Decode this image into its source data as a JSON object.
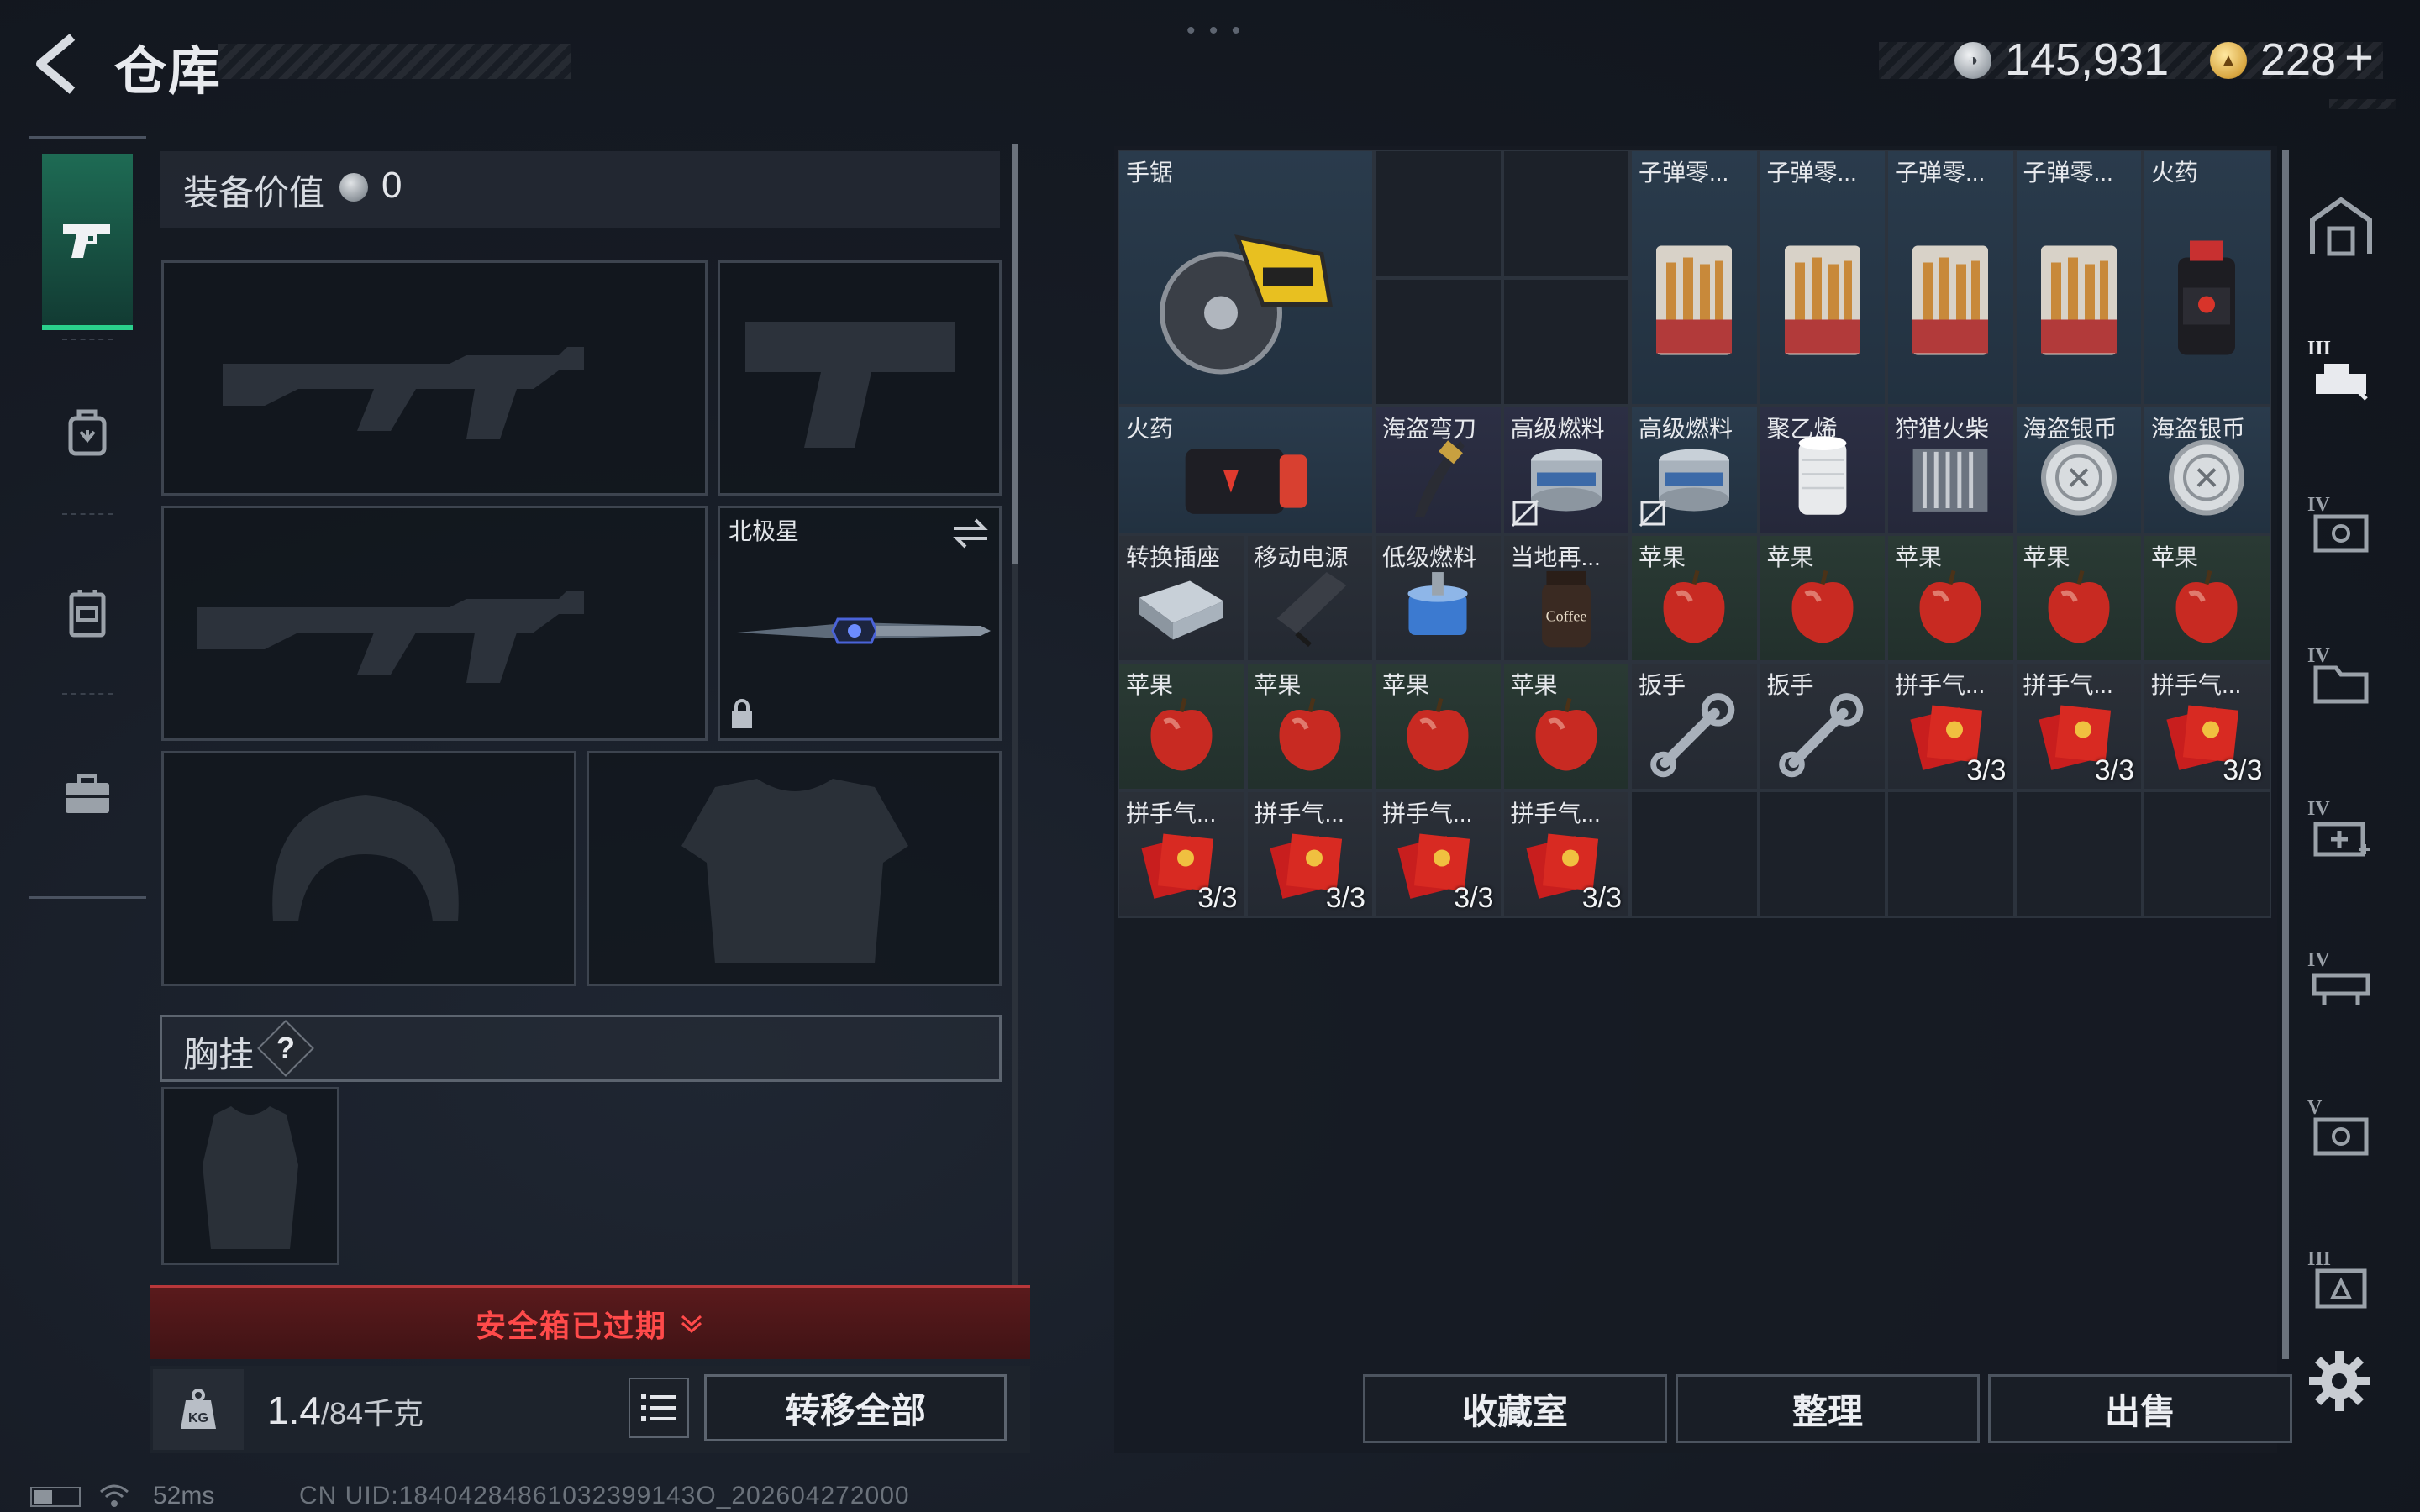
{
  "header": {
    "title": "仓库",
    "silver_amount": "145,931",
    "gold_amount": "228",
    "gold_plus": "+"
  },
  "loadout": {
    "equip_value_label": "装备价值",
    "equip_value": "0",
    "melee_name": "北极星",
    "chest_rig_label": "胸挂",
    "chest_help": "?",
    "safe_box_status": "安全箱已过期",
    "weight_current": "1.4",
    "weight_max": "/84千克",
    "transfer_all": "转移全部"
  },
  "storage": {
    "items": [
      {
        "name": "手锯",
        "icon": "circular-saw-icon",
        "tier": "blue"
      },
      {
        "name": "子弹零...",
        "icon": "ammo-parts-icon",
        "tier": "blue"
      },
      {
        "name": "子弹零...",
        "icon": "ammo-parts-icon",
        "tier": "blue"
      },
      {
        "name": "子弹零...",
        "icon": "ammo-parts-icon",
        "tier": "blue"
      },
      {
        "name": "子弹零...",
        "icon": "ammo-parts-icon",
        "tier": "blue"
      },
      {
        "name": "火药",
        "icon": "gunpowder-bottle-icon",
        "tier": "blue"
      },
      {
        "name": "火药",
        "icon": "gunpowder-canister-icon",
        "tier": "blue"
      },
      {
        "name": "海盗弯刀",
        "icon": "pirate-blade-icon",
        "tier": "purple"
      },
      {
        "name": "高级燃料",
        "icon": "fuel-can-icon",
        "tier": "purple"
      },
      {
        "name": "高级燃料",
        "icon": "fuel-can-icon",
        "tier": "blue"
      },
      {
        "name": "聚乙烯",
        "icon": "polyethylene-roll-icon",
        "tier": "purple"
      },
      {
        "name": "狩猎火柴",
        "icon": "hunting-matches-icon",
        "tier": "purple"
      },
      {
        "name": "海盗银币",
        "icon": "silver-coin-icon",
        "tier": "blue"
      },
      {
        "name": "海盗银币",
        "icon": "silver-coin-icon",
        "tier": "blue"
      },
      {
        "name": "转换插座",
        "icon": "power-adapter-icon",
        "tier": "gray"
      },
      {
        "name": "移动电源",
        "icon": "power-bank-icon",
        "tier": "gray"
      },
      {
        "name": "低级燃料",
        "icon": "fuel-burner-icon",
        "tier": "gray"
      },
      {
        "name": "当地再...",
        "icon": "coffee-jar-icon",
        "tier": "gray"
      },
      {
        "name": "苹果",
        "icon": "apple-icon",
        "tier": "green"
      },
      {
        "name": "苹果",
        "icon": "apple-icon",
        "tier": "green"
      },
      {
        "name": "苹果",
        "icon": "apple-icon",
        "tier": "green"
      },
      {
        "name": "苹果",
        "icon": "apple-icon",
        "tier": "green"
      },
      {
        "name": "苹果",
        "icon": "apple-icon",
        "tier": "green"
      },
      {
        "name": "苹果",
        "icon": "apple-icon",
        "tier": "green"
      },
      {
        "name": "苹果",
        "icon": "apple-icon",
        "tier": "green"
      },
      {
        "name": "苹果",
        "icon": "apple-icon",
        "tier": "green"
      },
      {
        "name": "苹果",
        "icon": "apple-icon",
        "tier": "green"
      },
      {
        "name": "扳手",
        "icon": "wrench-icon",
        "tier": "gray"
      },
      {
        "name": "扳手",
        "icon": "wrench-icon",
        "tier": "gray"
      },
      {
        "name": "拼手气...",
        "icon": "red-envelope-icon",
        "tier": "gray",
        "count": "3/3"
      },
      {
        "name": "拼手气...",
        "icon": "red-envelope-icon",
        "tier": "gray",
        "count": "3/3"
      },
      {
        "name": "拼手气...",
        "icon": "red-envelope-icon",
        "tier": "gray",
        "count": "3/3"
      },
      {
        "name": "拼手气...",
        "icon": "red-envelope-icon",
        "tier": "gray",
        "count": "3/3"
      },
      {
        "name": "拼手气...",
        "icon": "red-envelope-icon",
        "tier": "gray",
        "count": "3/3"
      },
      {
        "name": "拼手气...",
        "icon": "red-envelope-icon",
        "tier": "gray",
        "count": "3/3"
      },
      {
        "name": "拼手气...",
        "icon": "red-envelope-icon",
        "tier": "gray",
        "count": "3/3"
      }
    ],
    "buttons": {
      "collection": "收藏室",
      "organize": "整理",
      "sell": "出售"
    }
  },
  "right_bar": {
    "levels": [
      "III",
      "IV",
      "IV",
      "IV",
      "IV",
      "V",
      "III"
    ]
  },
  "status": {
    "ping": "52ms",
    "uid": "CN UID:18404284861032399143O_202604272000"
  },
  "colors": {
    "accent_green": "#2ad08c",
    "warning_red": "#ff4a4a",
    "tier_blue": "#2a3b4c",
    "tier_purple": "#2c2f44",
    "tier_green": "#2a3a34"
  }
}
